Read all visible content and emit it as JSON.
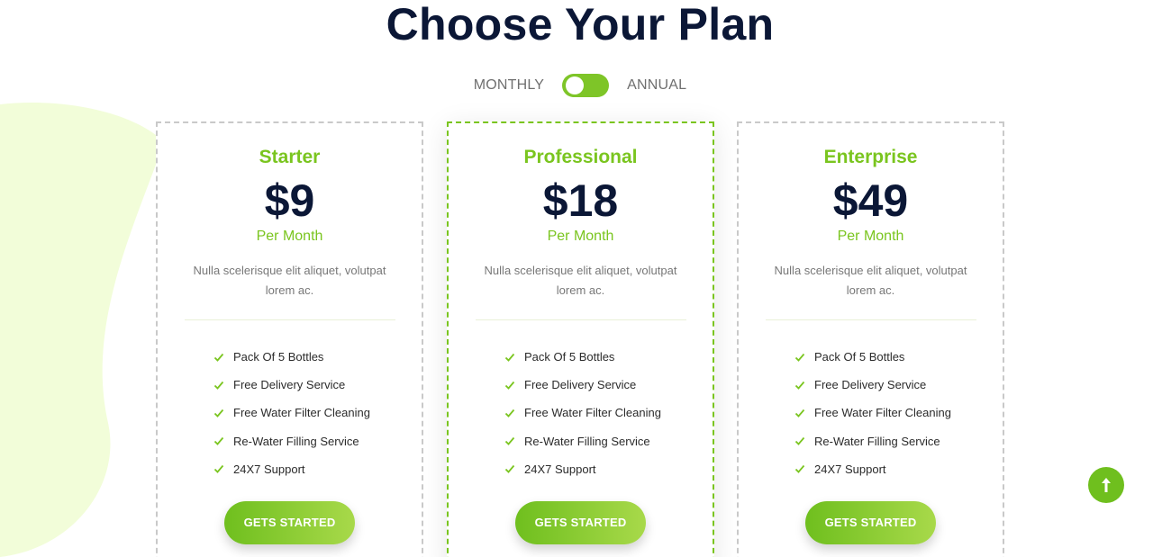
{
  "page": {
    "title": "Choose Your Plan"
  },
  "billing_toggle": {
    "left_label": "MONTHLY",
    "right_label": "ANNUAL"
  },
  "plans": [
    {
      "name": "Starter",
      "price": "$9",
      "period": "Per Month",
      "description": "Nulla scelerisque elit aliquet, volutpat lorem ac.",
      "features": [
        "Pack Of 5 Bottles",
        "Free Delivery Service",
        "Free Water Filter Cleaning",
        "Re-Water Filling Service",
        "24X7 Support"
      ],
      "cta_label": "GETS STARTED"
    },
    {
      "name": "Professional",
      "price": "$18",
      "period": "Per Month",
      "description": "Nulla scelerisque elit aliquet, volutpat lorem ac.",
      "features": [
        "Pack Of 5 Bottles",
        "Free Delivery Service",
        "Free Water Filter Cleaning",
        "Re-Water Filling Service",
        "24X7 Support"
      ],
      "cta_label": "GETS STARTED"
    },
    {
      "name": "Enterprise",
      "price": "$49",
      "period": "Per Month",
      "description": "Nulla scelerisque elit aliquet, volutpat lorem ac.",
      "features": [
        "Pack Of 5 Bottles",
        "Free Delivery Service",
        "Free Water Filter Cleaning",
        "Re-Water Filling Service",
        "24X7 Support"
      ],
      "cta_label": "GETS STARTED"
    }
  ],
  "icons": {
    "feature": "check-icon",
    "scroll": "arrow-up-icon"
  },
  "colors": {
    "accent": "#7ac51f",
    "heading": "#0b1736",
    "blob": "#f2fdd9"
  }
}
